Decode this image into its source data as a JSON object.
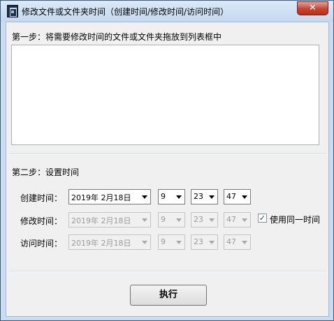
{
  "window": {
    "title": "修改文件或文件夹时间（创建时间/修改时间/访问时间）",
    "close_label": "✕"
  },
  "step1": {
    "label": "第一步：将需要修改时间的文件或文件夹拖放到列表框中"
  },
  "step2": {
    "label": "第二步：设置时间"
  },
  "rows": [
    {
      "label": "创建时间：",
      "date": "2019年 2月18日",
      "hour": "9",
      "minute": "23",
      "second": "47",
      "enabled": true
    },
    {
      "label": "修改时间：",
      "date": "2019年 2月18日",
      "hour": "9",
      "minute": "23",
      "second": "47",
      "enabled": false
    },
    {
      "label": "访问时间：",
      "date": "2019年 2月18日",
      "hour": "9",
      "minute": "23",
      "second": "47",
      "enabled": false
    }
  ],
  "same_time": {
    "label": "使用同一时间",
    "checked": true,
    "mark": "✓"
  },
  "execute": {
    "label": "执行"
  }
}
